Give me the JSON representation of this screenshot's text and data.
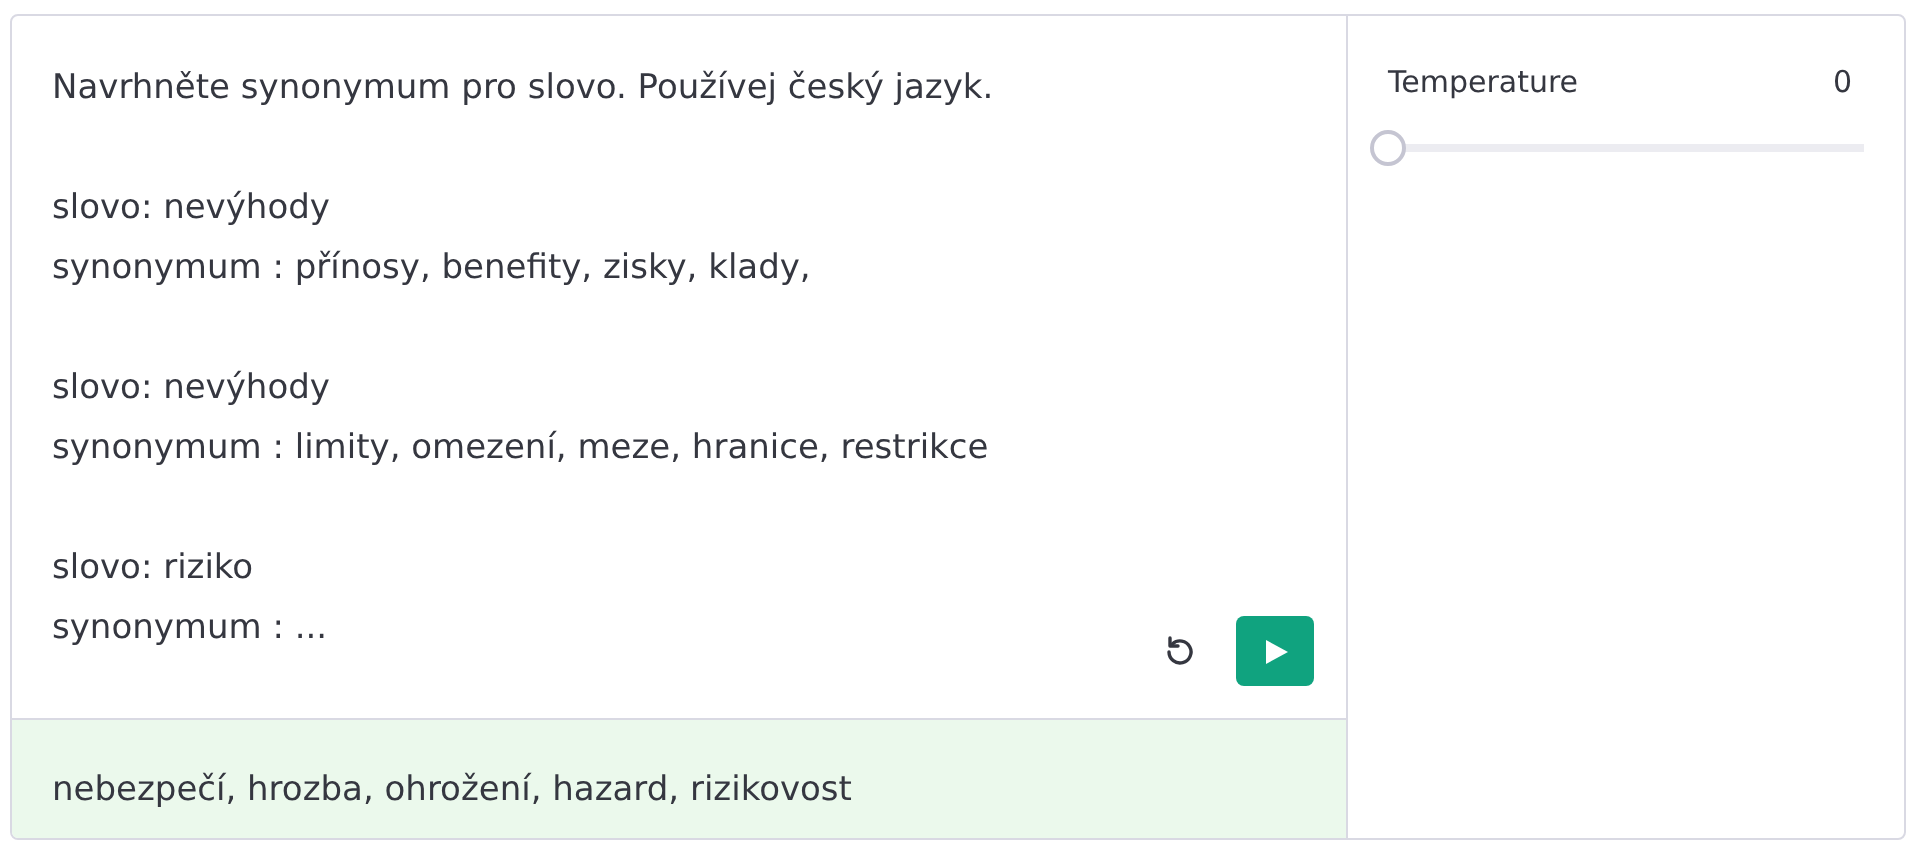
{
  "prompt": {
    "blocks": [
      [
        "Navrhněte synonymum pro slovo. Používej český jazyk."
      ],
      [
        "slovo: nevýhody",
        "synonymum : přínosy, benefity, zisky, klady,"
      ],
      [
        "slovo: nevýhody",
        "synonymum : limity, omezení, meze, hranice, restrikce"
      ],
      [
        "slovo: riziko",
        "synonymum : ..."
      ]
    ]
  },
  "output": "nebezpečí, hrozba, ohrožení, hazard, rizikovost",
  "settings": {
    "label": "Temperature",
    "value": "0",
    "level": 0
  }
}
